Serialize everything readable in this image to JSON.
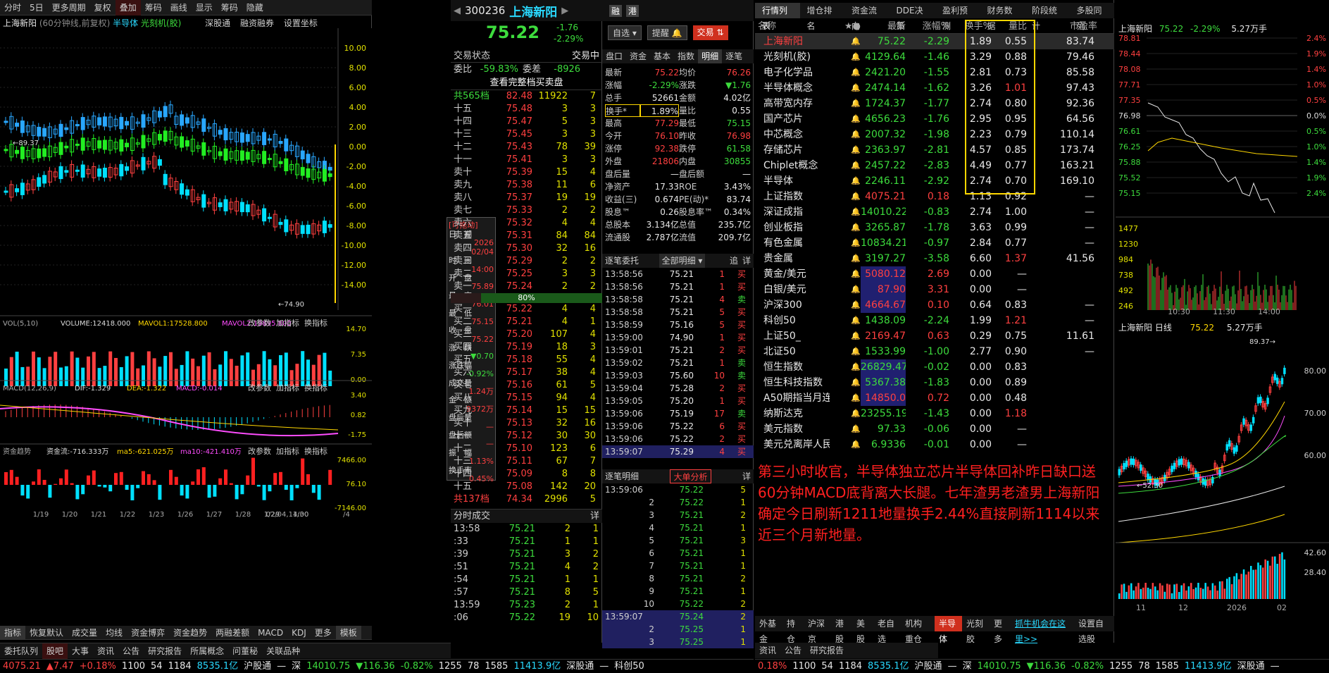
{
  "chart": {
    "toolbar": [
      "分时",
      "5日",
      "更多周期",
      "复权",
      "叠加",
      "筹码",
      "画线",
      "显示",
      "筹码",
      "隐藏"
    ],
    "title": "上海新阳",
    "subtitle": "(60分钟线,前复权)",
    "overlay1": "半导体",
    "overlay2": "光刻机(胶)",
    "links": [
      "深股通",
      "融资融券",
      "设置坐标"
    ],
    "yaxis": [
      "10.00",
      "8.00",
      "6.00",
      "4.00",
      "2.00",
      "0.00",
      "-2.00",
      "-4.00",
      "-6.00",
      "-8.00",
      "-10.00",
      "-12.00",
      "-14.00"
    ],
    "max_label": "89.37",
    "min_label": "74.90",
    "vol": {
      "label": "VOL(5,10)",
      "value": "VOLUME:12418.000",
      "ma1": "MAVOL1:17528.800",
      "ma2": "MAVOL2:19895.800",
      "axis": [
        "14.70",
        "7.35",
        "0.00"
      ]
    },
    "macd": {
      "label": "MACD(12,26,9)",
      "dif": "DIF:-1.329",
      "dea": "DEA:-1.322",
      "macd": "MACD:-0.014",
      "axis": [
        "3.40",
        "0.82",
        "-1.75"
      ]
    },
    "fund": {
      "label": "资金趋势",
      "flow": "资金流:-716.333万",
      "ma5": "ma5:-621.025万",
      "ma10": "ma10:-421.410万",
      "axis": [
        "7466.00",
        "76.10",
        "-7146.00"
      ]
    },
    "actions": [
      "改参数",
      "加指标",
      "换指标"
    ],
    "dates": [
      "1/19",
      "1/20",
      "1/21",
      "1/22",
      "1/23",
      "1/26",
      "1/27",
      "1/28",
      "1/29",
      "1/30",
      "02/04,14:00",
      "/4"
    ],
    "tabs": [
      "指标",
      "恢复默认",
      "成交量",
      "均线",
      "资金博弈",
      "资金趋势",
      "两融差额",
      "MACD",
      "KDJ",
      "更多",
      "模板"
    ]
  },
  "popup": {
    "title": "[可拖动]",
    "rows": [
      [
        "日　期",
        ""
      ],
      [
        "",
        "2026"
      ],
      [
        "",
        "02/04"
      ],
      [
        "时　间",
        ""
      ],
      [
        "",
        "14:00"
      ],
      [
        "开　盘",
        ""
      ],
      [
        "",
        "75.89"
      ],
      [
        "最　高",
        ""
      ],
      [
        "",
        "76.01"
      ],
      [
        "最　低",
        ""
      ],
      [
        "",
        "75.15"
      ],
      [
        "收　盘",
        ""
      ],
      [
        "",
        "75.22"
      ],
      [
        "涨　跌",
        ""
      ],
      [
        "",
        "▼0.70"
      ],
      [
        "涨跌幅",
        ""
      ],
      [
        "",
        "-0.92%"
      ],
      [
        "成交量",
        ""
      ],
      [
        "",
        "1.24万"
      ],
      [
        "金　额",
        ""
      ],
      [
        "",
        "9372万"
      ],
      [
        "盘后量",
        ""
      ],
      [
        "",
        "—"
      ],
      [
        "盘后额",
        ""
      ],
      [
        "",
        "—"
      ],
      [
        "振　幅",
        ""
      ],
      [
        "",
        "1.13%"
      ],
      [
        "换手率",
        ""
      ],
      [
        "",
        "0.45%"
      ]
    ]
  },
  "quote": {
    "code": "300236",
    "name": "上海新阳",
    "price": "75.22",
    "chg": "-1.76",
    "pct": "-2.29%",
    "badge1": "融",
    "badge2": "港",
    "btn_watch": "自选",
    "btn_alert": "提醒",
    "btn_trade": "交易",
    "state_label": "交易状态",
    "state": "交易中",
    "wb_label": "委比",
    "wb": "-59.83%",
    "wc_label": "委差",
    "wc": "-8926",
    "full_btn": "查看完整档买卖盘",
    "sell_total": [
      "共565档",
      "82.48",
      "11922",
      "7"
    ],
    "sells": [
      [
        "十五",
        "75.48",
        "3",
        "3"
      ],
      [
        "十四",
        "75.47",
        "5",
        "3"
      ],
      [
        "十三",
        "75.45",
        "3",
        "3"
      ],
      [
        "十二",
        "75.43",
        "78",
        "39"
      ],
      [
        "十一",
        "75.41",
        "3",
        "3"
      ],
      [
        "卖十",
        "75.39",
        "15",
        "4"
      ],
      [
        "卖九",
        "75.38",
        "11",
        "6"
      ],
      [
        "卖八",
        "75.37",
        "19",
        "19"
      ],
      [
        "卖七",
        "75.33",
        "2",
        "2"
      ],
      [
        "卖六",
        "75.32",
        "4",
        "4"
      ],
      [
        "卖五",
        "75.31",
        "84",
        "84"
      ],
      [
        "卖四",
        "75.30",
        "32",
        "16"
      ],
      [
        "卖三",
        "75.29",
        "2",
        "2"
      ],
      [
        "卖二",
        "75.25",
        "3",
        "3"
      ],
      [
        "卖一",
        "75.24",
        "2",
        "2"
      ]
    ],
    "ratio": "80%",
    "buys": [
      [
        "买一",
        "75.22",
        "4",
        "4"
      ],
      [
        "买二",
        "75.21",
        "4",
        "1"
      ],
      [
        "买三",
        "75.20",
        "107",
        "4"
      ],
      [
        "买四",
        "75.19",
        "18",
        "3"
      ],
      [
        "买五",
        "75.18",
        "55",
        "4"
      ],
      [
        "买六",
        "75.17",
        "38",
        "4"
      ],
      [
        "买七",
        "75.16",
        "61",
        "5"
      ],
      [
        "买八",
        "75.15",
        "94",
        "4"
      ],
      [
        "买九",
        "75.14",
        "15",
        "15"
      ],
      [
        "买十",
        "75.13",
        "32",
        "16"
      ],
      [
        "十一",
        "75.12",
        "30",
        "30"
      ],
      [
        "十二",
        "75.10",
        "123",
        "6"
      ],
      [
        "十三",
        "75.11",
        "67",
        "7"
      ],
      [
        "十四",
        "75.09",
        "8",
        "8"
      ],
      [
        "十五",
        "75.08",
        "142",
        "20"
      ]
    ],
    "buy_total": [
      "共137档",
      "74.34",
      "2996",
      "5"
    ],
    "tick_title": "分时成交",
    "tick_btn": "详",
    "ticks": [
      [
        "13:58",
        "75.21",
        "2",
        "1"
      ],
      [
        ":33",
        "75.21",
        "1",
        "1"
      ],
      [
        ":39",
        "75.21",
        "3",
        "2"
      ],
      [
        ":51",
        "75.21",
        "4",
        "2"
      ],
      [
        ":54",
        "75.21",
        "1",
        "1"
      ],
      [
        ":57",
        "75.21",
        "8",
        "5"
      ],
      [
        "13:59",
        "75.23",
        "2",
        "1"
      ],
      [
        ":06",
        "75.22",
        "19",
        "10"
      ]
    ]
  },
  "detail": {
    "tabs": [
      "盘口",
      "资金",
      "基本",
      "指数",
      "明细",
      "逐笔"
    ],
    "rows": [
      [
        "最新",
        "75.22",
        "均价",
        "76.26"
      ],
      [
        "涨幅",
        "-2.29%",
        "涨跌",
        "▼1.76"
      ],
      [
        "总手",
        "52661",
        "金额",
        "4.02亿"
      ],
      [
        "换手*",
        "1.89%",
        "量比",
        "0.55"
      ],
      [
        "最高",
        "77.29",
        "最低",
        "75.15"
      ],
      [
        "今开",
        "76.10",
        "昨收",
        "76.98"
      ],
      [
        "涨停",
        "92.38",
        "跌停",
        "61.58"
      ],
      [
        "外盘",
        "21806",
        "内盘",
        "30855"
      ],
      [
        "盘后量",
        "—",
        "盘后额",
        "—"
      ],
      [
        "净资产",
        "17.33",
        "ROE",
        "3.43%"
      ],
      [
        "收益(三)",
        "0.674",
        "PE(动)*",
        "83.74"
      ],
      [
        "股息™",
        "0.26",
        "股息率™",
        "0.34%"
      ],
      [
        "总股本",
        "3.134亿",
        "总值",
        "235.7亿"
      ],
      [
        "流通股",
        "2.787亿",
        "流值",
        "209.7亿"
      ]
    ],
    "entrust_title": "逐笔委托",
    "entrust_sel": "全部明细",
    "entrust_btns": [
      "追",
      "详"
    ],
    "entrust": [
      [
        "13:58:56",
        "75.21",
        "1",
        "买"
      ],
      [
        "13:58:56",
        "75.21",
        "1",
        "买"
      ],
      [
        "13:58:58",
        "75.21",
        "4",
        "卖"
      ],
      [
        "13:58:58",
        "75.21",
        "5",
        "买"
      ],
      [
        "13:58:59",
        "75.16",
        "5",
        "买"
      ],
      [
        "13:59:00",
        "74.90",
        "1",
        "买"
      ],
      [
        "13:59:01",
        "75.21",
        "2",
        "买"
      ],
      [
        "13:59:02",
        "75.21",
        "1",
        "卖"
      ],
      [
        "13:59:03",
        "75.60",
        "10",
        "卖"
      ],
      [
        "13:59:04",
        "75.28",
        "2",
        "买"
      ],
      [
        "13:59:05",
        "75.20",
        "1",
        "买"
      ],
      [
        "13:59:06",
        "75.19",
        "17",
        "卖"
      ],
      [
        "13:59:06",
        "75.22",
        "6",
        "买"
      ],
      [
        "13:59:06",
        "75.22",
        "2",
        "买"
      ],
      [
        "13:59:07",
        "75.29",
        "4",
        "买"
      ]
    ],
    "bigorder_title": "逐笔明细",
    "bigorder_btn": "大单分析",
    "bigorder_detail": "详",
    "big": [
      [
        "13:59:06",
        "75.22",
        "5"
      ],
      [
        "2",
        "75.22",
        "1"
      ],
      [
        "3",
        "75.21",
        "2"
      ],
      [
        "4",
        "75.21",
        "1"
      ],
      [
        "5",
        "75.21",
        "3"
      ],
      [
        "6",
        "75.21",
        "1"
      ],
      [
        "7",
        "75.21",
        "1"
      ],
      [
        "8",
        "75.21",
        "2"
      ],
      [
        "9",
        "75.21",
        "1"
      ],
      [
        "10",
        "75.22",
        "2"
      ],
      [
        "13:59:07",
        "75.24",
        "2"
      ],
      [
        "2",
        "75.25",
        "1"
      ],
      [
        "3",
        "75.25",
        "1"
      ]
    ]
  },
  "market": {
    "tabs": [
      "行情列表",
      "增仓排名",
      "资金流向",
      "DDE决策",
      "盈利预测",
      "财务数据",
      "阶段统计",
      "多股同列"
    ],
    "headers": [
      "名称",
      "★●",
      "最新",
      "涨幅%",
      "换手%",
      "量比",
      "市盈率"
    ],
    "rows": [
      [
        "上海新阳",
        "75.22",
        "-2.29",
        "1.89",
        "0.55",
        "83.74"
      ],
      [
        "光刻机(胶)",
        "4129.64",
        "-1.46",
        "3.29",
        "0.88",
        "79.46"
      ],
      [
        "电子化学品",
        "2421.20",
        "-1.55",
        "2.81",
        "0.73",
        "85.58"
      ],
      [
        "半导体概念",
        "2474.14",
        "-1.62",
        "3.26",
        "1.01",
        "97.43"
      ],
      [
        "高带宽内存",
        "1724.37",
        "-1.77",
        "2.74",
        "0.80",
        "92.36"
      ],
      [
        "国产芯片",
        "4656.23",
        "-1.76",
        "2.95",
        "0.95",
        "64.56"
      ],
      [
        "中芯概念",
        "2007.32",
        "-1.98",
        "2.23",
        "0.79",
        "110.14"
      ],
      [
        "存储芯片",
        "2363.97",
        "-2.81",
        "4.57",
        "0.85",
        "173.74"
      ],
      [
        "Chiplet概念",
        "2457.22",
        "-2.83",
        "4.49",
        "0.77",
        "163.21"
      ],
      [
        "半导体",
        "2246.11",
        "-2.92",
        "2.74",
        "0.70",
        "169.10"
      ],
      [
        "上证指数",
        "4075.21",
        "0.18",
        "1.13",
        "0.92",
        "—"
      ],
      [
        "深证成指",
        "14010.22",
        "-0.83",
        "2.74",
        "1.00",
        "—"
      ],
      [
        "创业板指",
        "3265.87",
        "-1.78",
        "3.63",
        "0.99",
        "—"
      ],
      [
        "有色金属",
        "10834.21",
        "-0.97",
        "2.84",
        "0.77",
        "—"
      ],
      [
        "贵金属",
        "3197.27",
        "-3.58",
        "6.60",
        "1.37",
        "41.56"
      ],
      [
        "黄金/美元",
        "5080.12",
        "2.69",
        "0.00",
        "—",
        ""
      ],
      [
        "白银/美元",
        "87.90",
        "3.31",
        "0.00",
        "—",
        ""
      ],
      [
        "沪深300",
        "4664.67",
        "0.10",
        "0.64",
        "0.83",
        "—"
      ],
      [
        "科创50",
        "1438.09",
        "-2.24",
        "1.99",
        "1.21",
        "—"
      ],
      [
        "上证50_",
        "2169.47",
        "0.63",
        "0.29",
        "0.75",
        "11.61"
      ],
      [
        "北证50",
        "1533.99",
        "-1.00",
        "2.77",
        "0.90",
        "—"
      ],
      [
        "恒生指数",
        "26829.47",
        "-0.02",
        "0.00",
        "0.83",
        ""
      ],
      [
        "恒生科技指数",
        "5367.38",
        "-1.83",
        "0.00",
        "0.89",
        ""
      ],
      [
        "A50期指当月连续",
        "14850.0",
        "0.72",
        "0.00",
        "0.48",
        ""
      ],
      [
        "纳斯达克",
        "23255.19",
        "-1.43",
        "0.00",
        "1.18",
        ""
      ],
      [
        "美元指数",
        "97.33",
        "-0.06",
        "0.00",
        "—",
        ""
      ],
      [
        "美元兑离岸人民币",
        "6.9336",
        "-0.01",
        "0.00",
        "—",
        ""
      ]
    ],
    "note": "第三小时收官，半导体独立芯片半导体回补昨日缺口送60分钟MACD底背离大长腿。七年渣男老渣男上海新阳确定今日刷新1211地量换手2.44%直接刷新1114以来近三个月新地量。",
    "bottom_tabs": [
      "外基金",
      "持仓",
      "沪深京",
      "港股",
      "美股",
      "老自选",
      "机构重仓",
      "半导体",
      "光刻胶",
      "更多",
      "抓牛机会在这里>>",
      "设置自选股"
    ]
  },
  "mini": {
    "title": "上海新阳",
    "price": "75.22",
    "pct": "-2.29%",
    "turnover": "5.27万手",
    "left_axis": [
      "78.81",
      "78.44",
      "78.08",
      "77.71",
      "77.35",
      "76.98",
      "76.61",
      "76.25",
      "75.88",
      "75.52",
      "75.15"
    ],
    "right_axis": [
      "2.4%",
      "1.9%",
      "1.4%",
      "1.0%",
      "0.5%",
      "0.0%",
      "0.5%",
      "1.0%",
      "1.4%",
      "1.9%",
      "2.4%"
    ],
    "vol_axis": [
      "1477",
      "1230",
      "984",
      "738",
      "492",
      "246"
    ],
    "times": [
      "10:30",
      "11:30",
      "14:00"
    ],
    "daily_title": "上海新阳 日线",
    "daily_price": "75.22",
    "daily_vol": "5.27万手",
    "daily_max": "89.37",
    "daily_min": "52.30",
    "daily_axis": [
      "80.00",
      "70.00",
      "60.00"
    ],
    "daily_vol_axis": [
      "42.60",
      "28.40"
    ],
    "daily_dates": [
      "11",
      "12",
      "2026",
      "02"
    ]
  },
  "status": {
    "tabs": [
      "委托队列",
      "股吧",
      "大事",
      "资讯",
      "公告",
      "研究报告",
      "所属概念",
      "问董秘",
      "关联品种"
    ],
    "tabs2": [
      "资讯",
      "公告",
      "研究报告"
    ],
    "ticker": [
      [
        "4075.21",
        "red"
      ],
      [
        "▲7.47",
        "red"
      ],
      [
        "+0.18%",
        "red"
      ],
      [
        "1100",
        "wht"
      ],
      [
        "54",
        "wht"
      ],
      [
        "1184",
        "wht"
      ],
      [
        "8535.1亿",
        "cyn"
      ],
      [
        "沪股通",
        "wht"
      ],
      [
        "—",
        "wht"
      ],
      [
        "深",
        "wht"
      ],
      [
        "14010.75",
        "grn"
      ],
      [
        "▼116.36",
        "grn"
      ],
      [
        "-0.82%",
        "grn"
      ],
      [
        "1255",
        "wht"
      ],
      [
        "78",
        "wht"
      ],
      [
        "1585",
        "wht"
      ],
      [
        "11413.9亿",
        "cyn"
      ],
      [
        "深股通",
        "wht"
      ],
      [
        "—",
        "wht"
      ],
      [
        "科创50",
        "wht"
      ]
    ],
    "ticker2": [
      [
        "0.18%",
        "red"
      ],
      [
        "1100",
        "wht"
      ],
      [
        "54",
        "wht"
      ],
      [
        "1184",
        "wht"
      ],
      [
        "8535.1亿",
        "cyn"
      ],
      [
        "沪股通",
        "wht"
      ],
      [
        "—",
        "wht"
      ],
      [
        "深",
        "wht"
      ],
      [
        "14010.75",
        "grn"
      ],
      [
        "▼116.36",
        "grn"
      ],
      [
        "-0.82%",
        "grn"
      ],
      [
        "1255",
        "wht"
      ],
      [
        "78",
        "wht"
      ],
      [
        "1585",
        "wht"
      ],
      [
        "11413.9亿",
        "cyn"
      ],
      [
        "深股通",
        "wht"
      ],
      [
        "—",
        "wht"
      ]
    ]
  }
}
